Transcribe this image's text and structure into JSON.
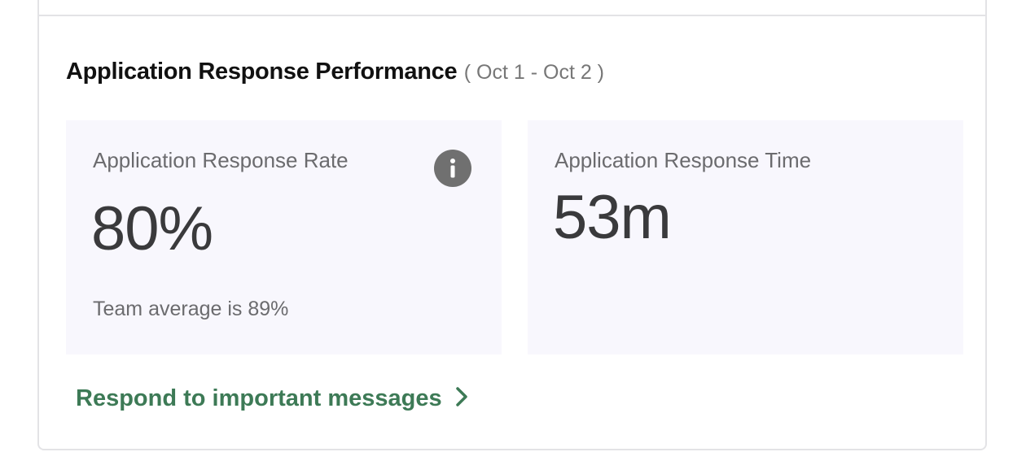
{
  "panel": {
    "title": "Application Response Performance",
    "date_range": "( Oct 1 - Oct 2 )"
  },
  "metrics": {
    "response_rate": {
      "label": "Application Response Rate",
      "value": "80%",
      "footnote": "Team average is 89%",
      "info_icon": "info-icon"
    },
    "response_time": {
      "label": "Application Response Time",
      "value": "53m"
    }
  },
  "cta": {
    "label": "Respond to important messages",
    "icon": "chevron-right-icon"
  },
  "colors": {
    "accent_green": "#3d7a56",
    "metric_bg": "#f8f7fd",
    "value_text": "#3a3a3c",
    "muted_text": "#6b6b6e",
    "info_icon_bg": "#707070"
  }
}
